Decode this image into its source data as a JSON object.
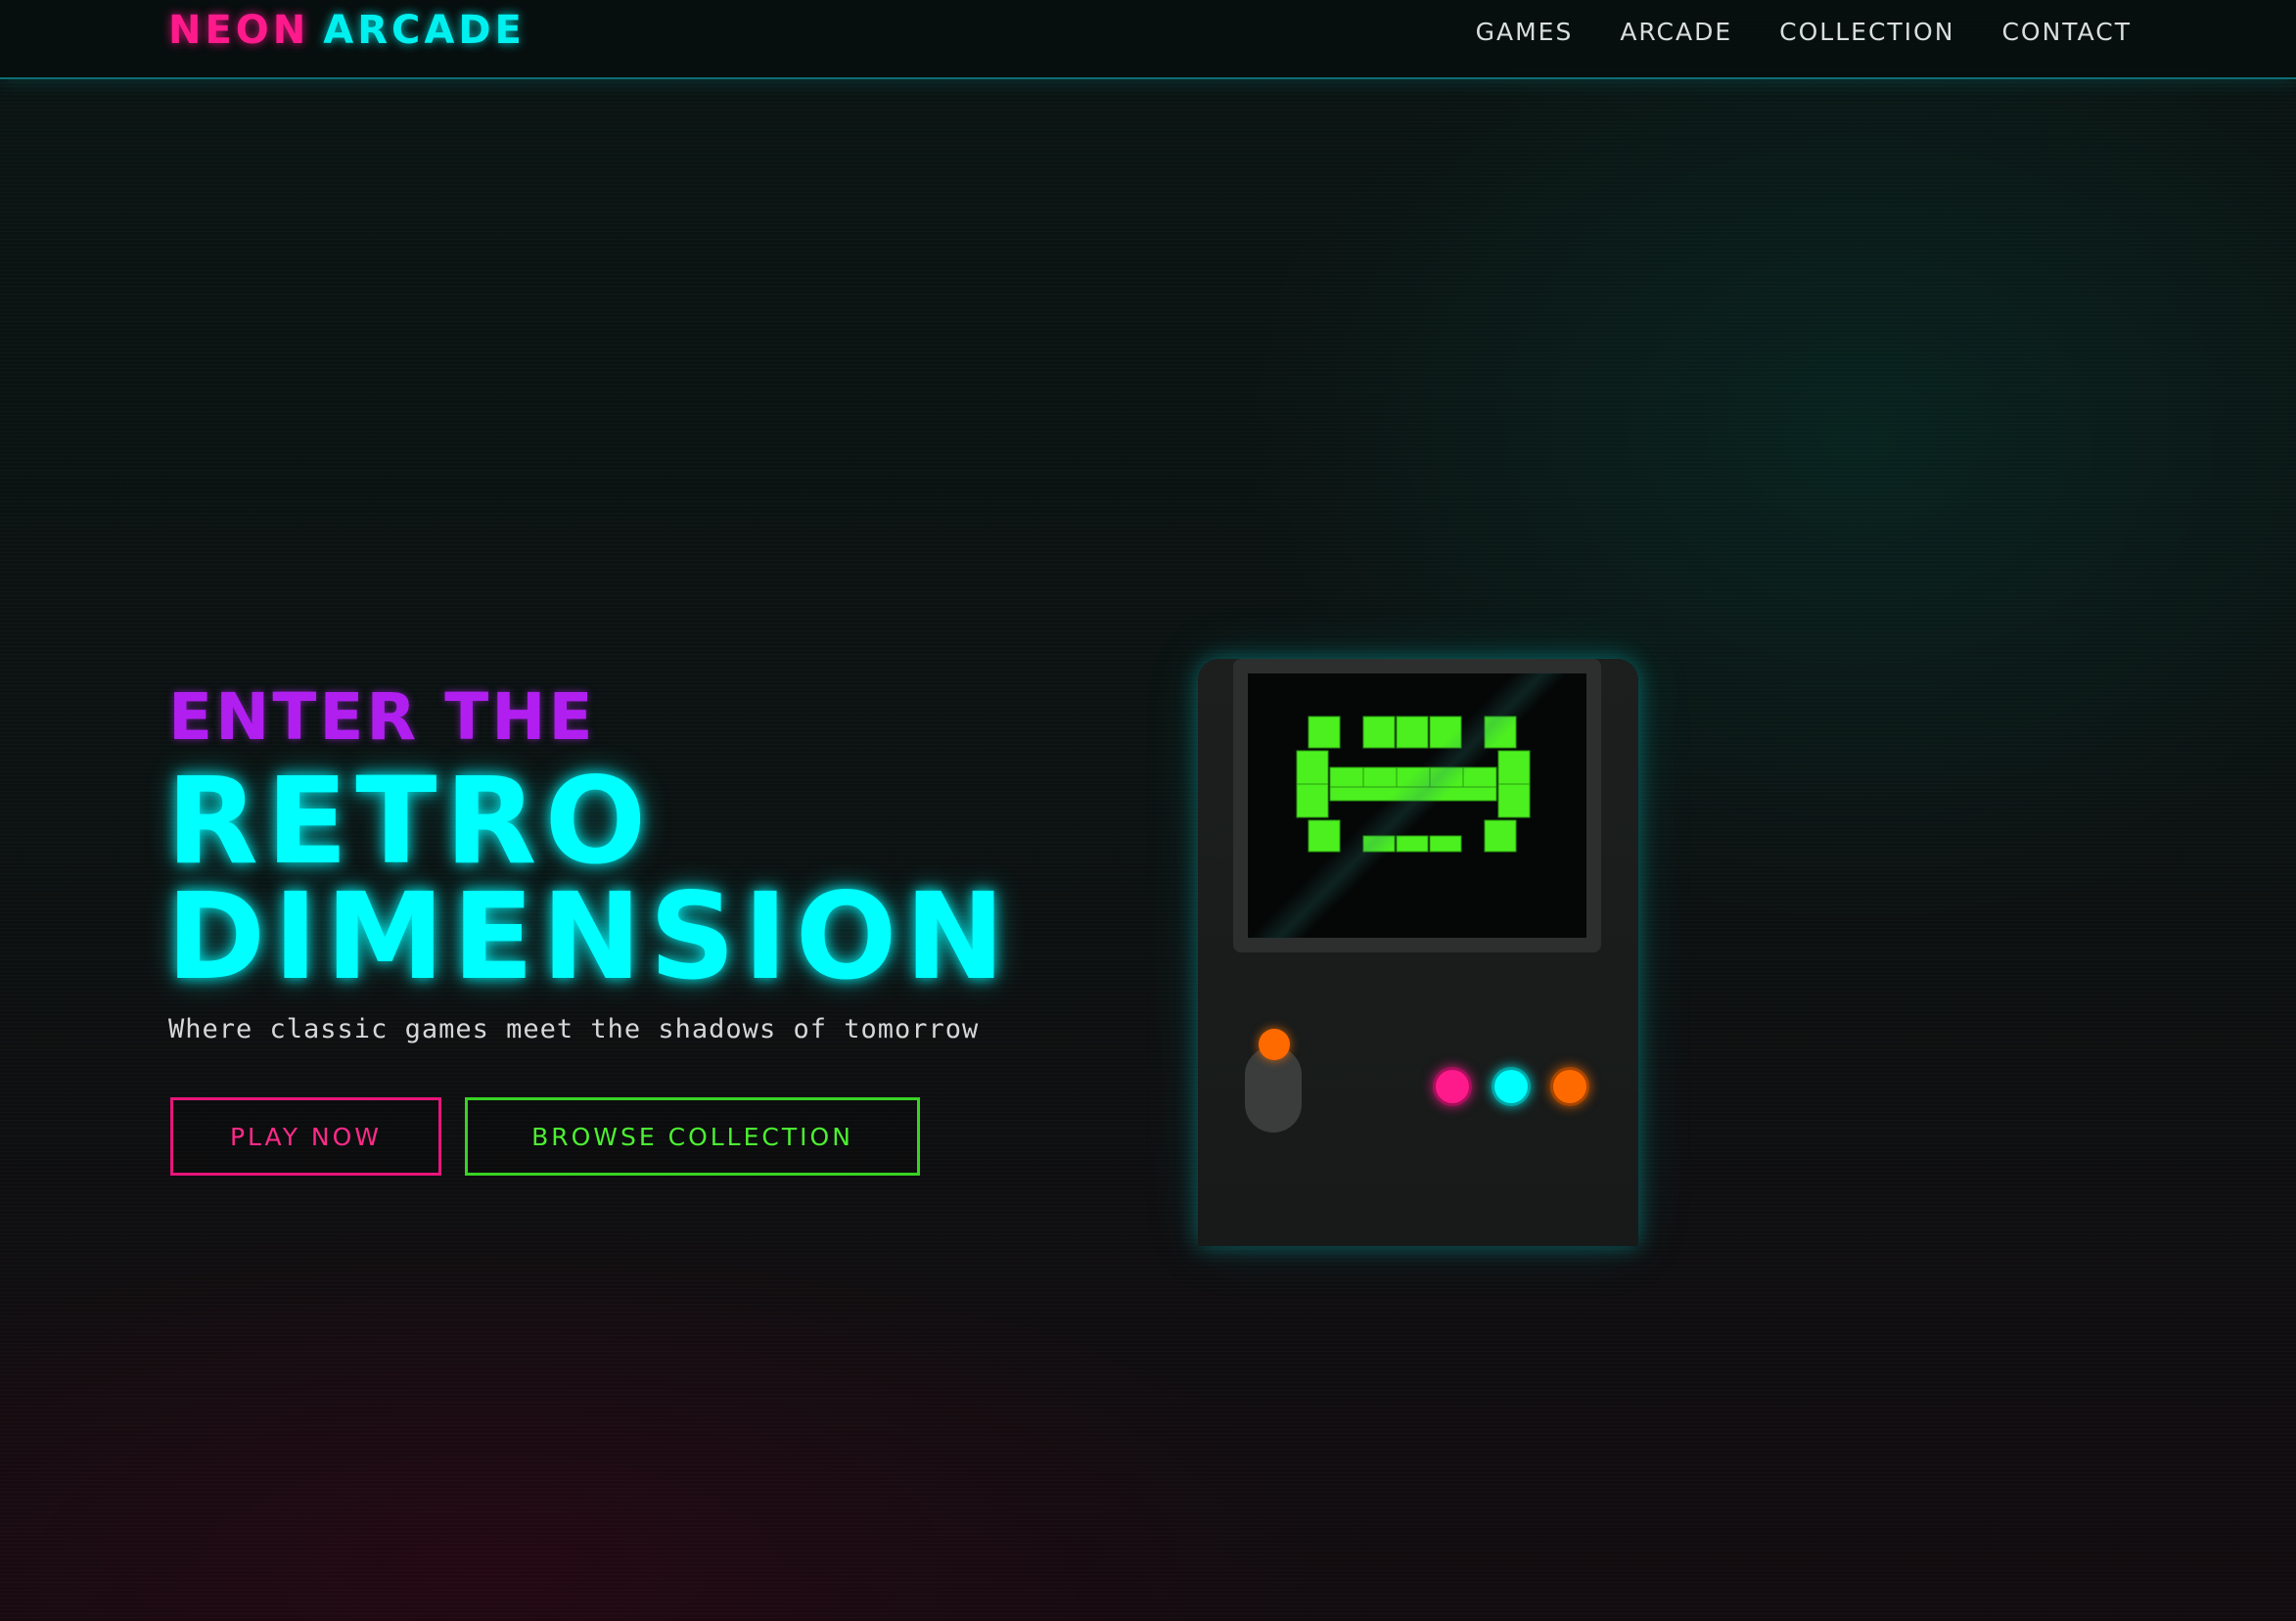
{
  "nav": {
    "logo_part1": "NEON",
    "logo_part2": "ARCADE",
    "links": [
      "GAMES",
      "ARCADE",
      "COLLECTION",
      "CONTACT"
    ]
  },
  "hero": {
    "kicker": "ENTER THE",
    "title_line1": "RETRO",
    "title_line2": "DIMENSION",
    "subtitle": "Where classic games meet the shadows of tomorrow",
    "primary_button": "PLAY NOW",
    "secondary_button": "BROWSE COLLECTION"
  },
  "cabinet": {
    "screen_icon": "space-invader-icon",
    "joystick_color": "#ff6a00",
    "button_colors": [
      "#ff1a8c",
      "#00ffff",
      "#ff6a00"
    ]
  },
  "colors": {
    "accent_pink": "#ff1a8c",
    "accent_cyan": "#00ffff",
    "accent_purple": "#b01ff0",
    "accent_green": "#4cf032"
  }
}
